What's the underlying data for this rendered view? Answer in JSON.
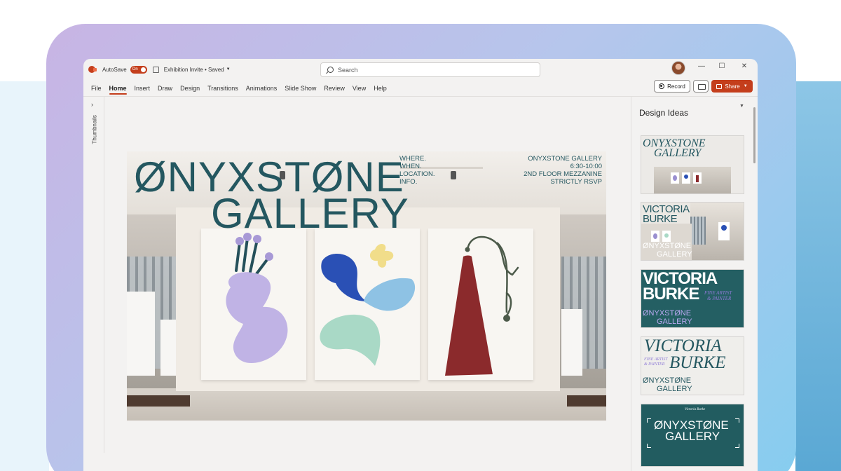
{
  "titlebar": {
    "autosave_label": "AutoSave",
    "autosave_state": "On",
    "doc_title": "Exhibition Invite • Saved",
    "search_placeholder": "Search",
    "minimize": "—",
    "maximize": "☐",
    "close": "✕"
  },
  "ribbon": {
    "tabs": [
      "File",
      "Home",
      "Insert",
      "Draw",
      "Design",
      "Transitions",
      "Animations",
      "Slide Show",
      "Review",
      "View",
      "Help"
    ],
    "active_tab": "Home",
    "record_label": "Record",
    "share_label": "Share"
  },
  "thumbnails": {
    "label": "Thumbnails",
    "expand": "›"
  },
  "slide": {
    "title_line1": "ØNYXSTØNE",
    "title_line2": "GALLERY",
    "info_left": [
      "WHERE.",
      "WHEN.",
      "LOCATION.",
      "INFO."
    ],
    "info_right": [
      "ONYXSTONE GALLERY",
      "6:30-10:00",
      "2ND FLOOR MEZZANINE",
      "STRICTLY RSVP"
    ]
  },
  "design_ideas": {
    "title": "Design Ideas",
    "ideas": [
      {
        "line1": "ONYXSTONE",
        "line2": "GALLERY"
      },
      {
        "line1": "VICTORIA",
        "line2": "BURKE",
        "line3": "ØNYXSTØNE",
        "line4": "GALLERY"
      },
      {
        "line1": "VICTORIA",
        "line2": "BURKE",
        "tag1": "FINE ARTIST",
        "tag2": "& PAINTER",
        "line3": "ØNYXSTØNE",
        "line4": "GALLERY"
      },
      {
        "line1": "VICTORIA",
        "line2": "BURKE",
        "tag1": "FINE ARTIST",
        "tag2": "& PAINTER",
        "line3": "ØNYXSTØNE",
        "line4": "GALLERY"
      },
      {
        "top": "Victoria Burke",
        "line1": "ØNYXSTØNE",
        "line2": "GALLERY"
      }
    ]
  },
  "colors": {
    "accent": "#c43e1c",
    "gallery_teal": "#245760",
    "idea_teal": "#245f63",
    "idea_purple": "#8e7ad6"
  }
}
